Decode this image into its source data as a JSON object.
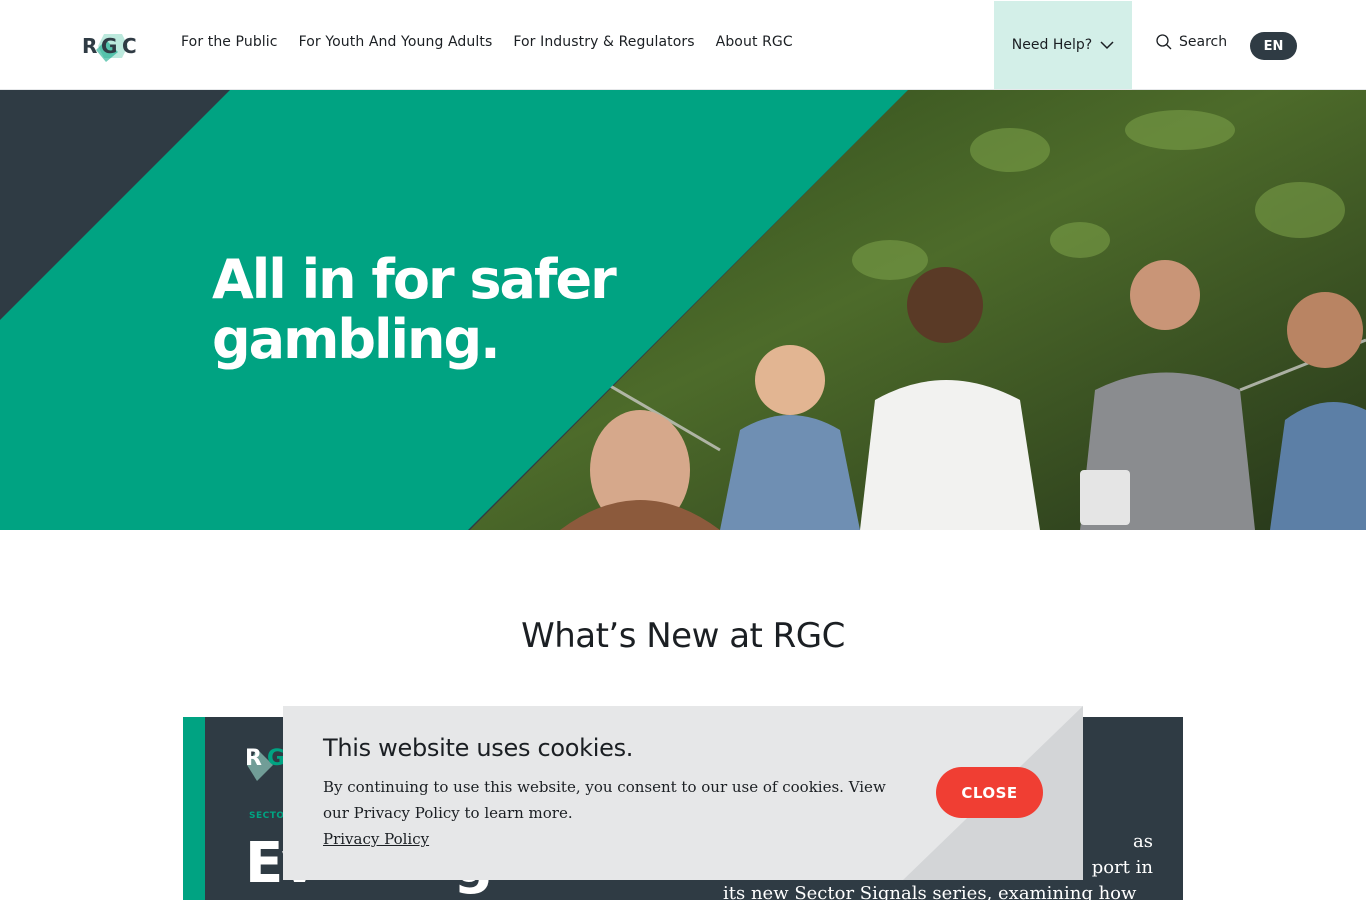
{
  "header": {
    "logo_text": "RGC",
    "nav": [
      {
        "label": "For the Public"
      },
      {
        "label": "For Youth And Young Adults"
      },
      {
        "label": "For Industry & Regulators"
      },
      {
        "label": "About RGC"
      }
    ],
    "need_help_label": "Need Help?",
    "search_label": "Search",
    "language_label": "EN"
  },
  "hero": {
    "title_line1": "All in for safer",
    "title_line2": "gambling."
  },
  "whats_new": {
    "title": "What’s New at RGC",
    "card": {
      "kicker": "SECTOR",
      "headline_fragment": "Ev",
      "headline_fragment2": "g",
      "description_line1": "as",
      "description_line2": "port in",
      "description_line3": "its new Sector Signals series, examining how"
    }
  },
  "cookie_banner": {
    "title": "This website uses cookies.",
    "body": "By continuing to use this website, you consent to our use of cookies. View our Privacy Policy to learn more.",
    "link_label": "Privacy Policy",
    "close_label": "CLOSE"
  },
  "colors": {
    "brand_green": "#00a382",
    "dark_slate": "#2f3b44",
    "help_bg": "#d3efe8",
    "close_red": "#f03e33"
  }
}
